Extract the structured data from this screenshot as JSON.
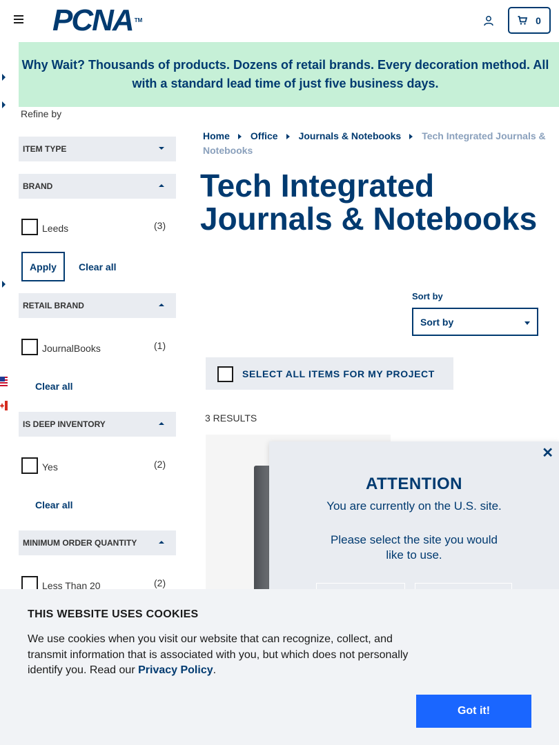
{
  "header": {
    "logo_text": "PCNA",
    "logo_tm": "TM",
    "cart_count": "0"
  },
  "banner": {
    "text": "Why Wait? Thousands of products. Dozens of retail brands. Every decoration method. All with a standard lead time of just five business days."
  },
  "sidebar": {
    "refine_label": "Refine by",
    "facets": [
      {
        "title": "ITEM TYPE",
        "state": "collapsed"
      },
      {
        "title": "BRAND",
        "state": "expanded",
        "options": [
          {
            "label": "Leeds",
            "count": "(3)"
          }
        ],
        "apply_label": "Apply",
        "clear_label": "Clear all"
      },
      {
        "title": "RETAIL BRAND",
        "state": "expanded",
        "options": [
          {
            "label": "JournalBooks",
            "count": "(1)"
          }
        ],
        "clear_label": "Clear all"
      },
      {
        "title": "IS DEEP INVENTORY",
        "state": "expanded",
        "options": [
          {
            "label": "Yes",
            "count": "(2)"
          }
        ],
        "clear_label": "Clear all"
      },
      {
        "title": "MINIMUM ORDER QUANTITY",
        "state": "expanded",
        "options": [
          {
            "label": "Less Than 20",
            "count": "(2)"
          }
        ]
      }
    ]
  },
  "breadcrumb": {
    "items": [
      "Home",
      "Office",
      "Journals & Notebooks"
    ],
    "current": "Tech Integrated Journals & Notebooks"
  },
  "main": {
    "title": "Tech Integrated Journals & Notebooks",
    "sort_label": "Sort by",
    "sort_value": "Sort by",
    "select_all_label": "SELECT ALL ITEMS FOR MY PROJECT",
    "results_text": "3 RESULTS"
  },
  "modal": {
    "title": "ATTENTION",
    "line1": "You are currently on the U.S. site.",
    "line2": "Please select the site you would like to use."
  },
  "cookie": {
    "title": "THIS WEBSITE USES COOKIES",
    "text": "We use cookies when you visit our website that can recognize, collect, and transmit information that is associated with you, but which does not personally identify you. Read our ",
    "link": "Privacy Policy",
    "period": ".",
    "button": "Got it!"
  },
  "colors": {
    "brand": "#003a70",
    "banner_bg": "#c6f0d7",
    "accent_button": "#1a66ff",
    "facet_bg": "#e9ecf1"
  },
  "icons": [
    "menu-icon",
    "user-icon",
    "cart-icon",
    "close-icon",
    "us-flag-icon",
    "canada-flag-icon"
  ]
}
